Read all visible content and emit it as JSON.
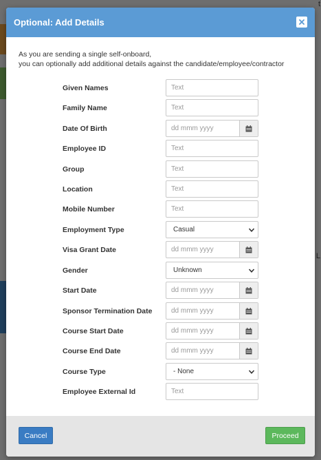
{
  "modal": {
    "title": "Optional: Add Details",
    "intro_line1": "As you are sending a single self-onboard,",
    "intro_line2": "you can optionally add additional details against the candidate/employee/contractor"
  },
  "form": {
    "given_names": {
      "label": "Given Names",
      "placeholder": "Text"
    },
    "family_name": {
      "label": "Family Name",
      "placeholder": "Text"
    },
    "date_of_birth": {
      "label": "Date Of Birth",
      "placeholder": "dd mmm yyyy"
    },
    "employee_id": {
      "label": "Employee ID",
      "placeholder": "Text"
    },
    "group": {
      "label": "Group",
      "placeholder": "Text"
    },
    "location": {
      "label": "Location",
      "placeholder": "Text"
    },
    "mobile_number": {
      "label": "Mobile Number",
      "placeholder": "Text"
    },
    "employment_type": {
      "label": "Employment Type",
      "value": "Casual"
    },
    "visa_grant_date": {
      "label": "Visa Grant Date",
      "placeholder": "dd mmm yyyy"
    },
    "gender": {
      "label": "Gender",
      "value": "Unknown"
    },
    "start_date": {
      "label": "Start Date",
      "placeholder": "dd mmm yyyy"
    },
    "sponsor_termination_date": {
      "label": "Sponsor Termination Date",
      "placeholder": "dd mmm yyyy"
    },
    "course_start_date": {
      "label": "Course Start Date",
      "placeholder": "dd mmm yyyy"
    },
    "course_end_date": {
      "label": "Course End Date",
      "placeholder": "dd mmm yyyy"
    },
    "course_type": {
      "label": "Course Type",
      "value": "- None"
    },
    "employee_external_id": {
      "label": "Employee External Id",
      "placeholder": "Text"
    }
  },
  "footer": {
    "cancel_label": "Cancel",
    "proceed_label": "Proceed"
  },
  "background": {
    "char_top": "t",
    "char_mid": "L"
  },
  "colors": {
    "header": "#5b9bd5",
    "cancel": "#3a7cc3",
    "proceed": "#5cb85c",
    "footer": "#e5e5e5"
  }
}
